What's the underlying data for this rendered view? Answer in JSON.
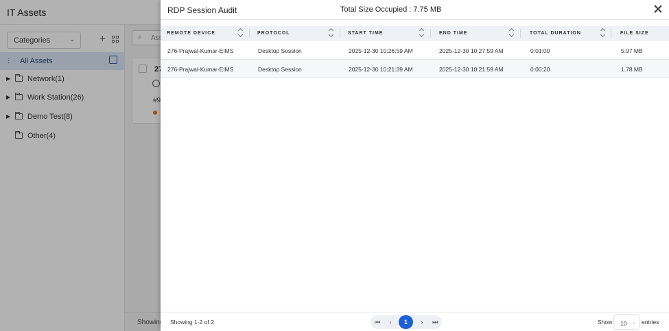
{
  "app": {
    "title": "IT Assets",
    "categories_label": "Categories",
    "search_placeholder": "Ass",
    "all_assets_label": "All Assets",
    "tree": [
      {
        "label": "Network(1)",
        "expandable": true
      },
      {
        "label": "Work Station(26)",
        "expandable": true
      },
      {
        "label": "Demo Test(8)",
        "expandable": true
      },
      {
        "label": "Other(4)",
        "expandable": false
      }
    ],
    "card": {
      "title": "27",
      "hash": "#9"
    },
    "footer_text": "Showing",
    "colors": {
      "selected_bg": "#dbe7f7",
      "status_dot": "#e07b10"
    }
  },
  "drawer": {
    "title": "RDP Session Audit",
    "total_size": "Total Size Occupied : 7.75 MB",
    "columns": [
      "REMOTE DEVICE",
      "PROTOCOL",
      "START TIME",
      "END TIME",
      "TOTAL DURATION",
      "FILE SIZE"
    ],
    "rows": [
      [
        "276-Prajwal-Kumar-EIMS",
        "Desktop Session",
        "2025-12-30 10:26:59 AM",
        "2025-12-30 10:27:59 AM",
        "0:01:00",
        "5.97 MB"
      ],
      [
        "276-Prajwal-Kumar-EIMS",
        "Desktop Session",
        "2025-12-30 10:21:39 AM",
        "2025-12-30 10:21:59 AM",
        "0:00:20",
        "1.78 MB"
      ]
    ],
    "footer": {
      "showing": "Showing 1-2 of 2",
      "current_page": "1",
      "show_label": "Show",
      "page_size": "10",
      "entries_label": "entries"
    },
    "colors": {
      "accent": "#1d5fd6",
      "header_bg": "#eef1f6"
    }
  }
}
